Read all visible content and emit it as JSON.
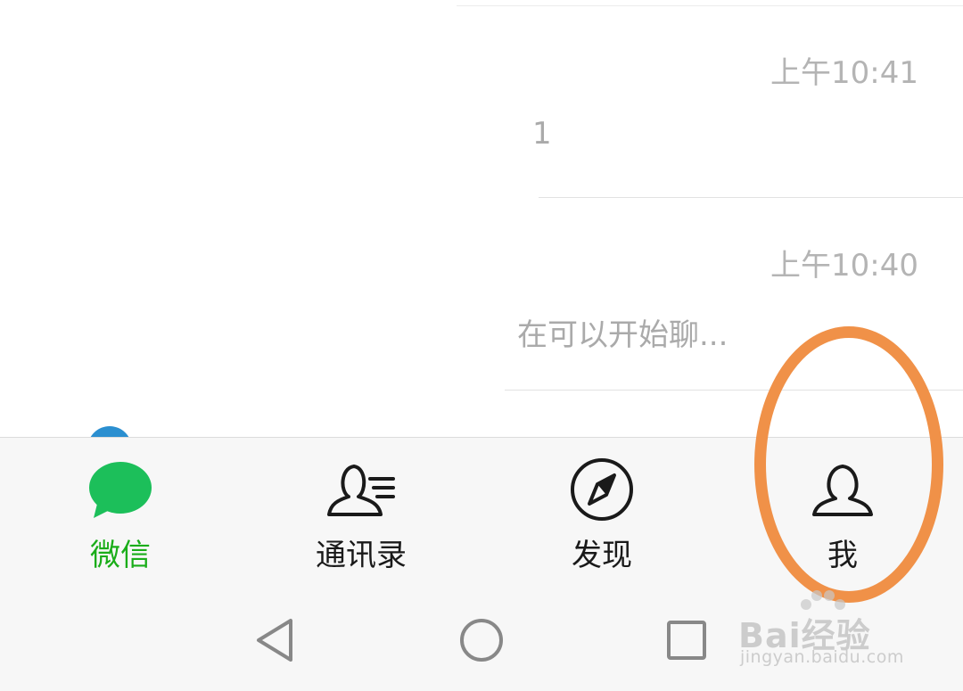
{
  "chat_list": {
    "items": [
      {
        "time": "上午10:41",
        "preview": "1"
      },
      {
        "time": "上午10:40",
        "preview": "在可以开始聊..."
      }
    ]
  },
  "tab_bar": {
    "tabs": [
      {
        "label": "微信",
        "icon": "chat-bubble-icon",
        "active": true
      },
      {
        "label": "通讯录",
        "icon": "contacts-icon",
        "active": false
      },
      {
        "label": "发现",
        "icon": "compass-icon",
        "active": false
      },
      {
        "label": "我",
        "icon": "profile-icon",
        "active": false
      }
    ]
  },
  "nav_bar": {
    "buttons": [
      "back-icon",
      "home-icon",
      "recents-icon"
    ]
  },
  "watermark": {
    "logo": "Bai经验",
    "url": "jingyan.baidu.com"
  },
  "colors": {
    "active_green": "#1aad19",
    "chat_icon_green": "#1cbf5a",
    "highlight_orange": "#f09148",
    "time_gray": "#b4b4b4"
  }
}
